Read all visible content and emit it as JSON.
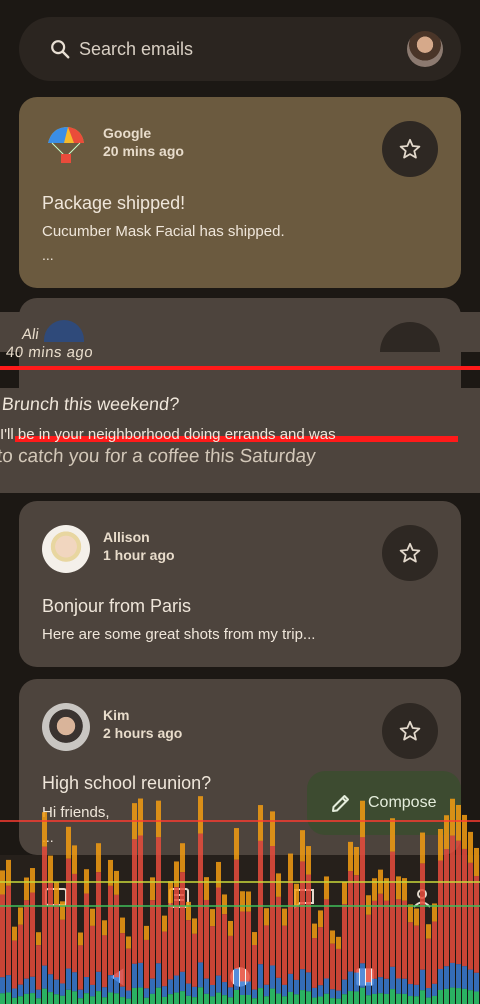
{
  "search": {
    "placeholder": "Search emails"
  },
  "emails": [
    {
      "sender": "Google",
      "time": "20 mins ago",
      "subject": "Package shipped!",
      "preview": "Cucumber Mask Facial has shipped.",
      "extra": "..."
    },
    {
      "sender": "Ali",
      "time": "40 mins ago",
      "subject": "Brunch this weekend?",
      "preview": "I'll be in your neighborhood doing errands and was",
      "preview2": "to catch you for a coffee this Saturday"
    },
    {
      "sender": "Allison",
      "time": "1 hour ago",
      "subject": "Bonjour from Paris",
      "preview": "Here are some great shots from my trip..."
    },
    {
      "sender": "Kim",
      "time": "2 hours ago",
      "subject": "High school reunion?",
      "preview": "Hi friends,",
      "extra": "..."
    }
  ],
  "fab": {
    "label": "Compose"
  },
  "colors": {
    "card": "#4d443d",
    "selected_card": "#6b5a3f",
    "fab": "#3d4b30",
    "glitch_red": "#ff1a1a"
  }
}
